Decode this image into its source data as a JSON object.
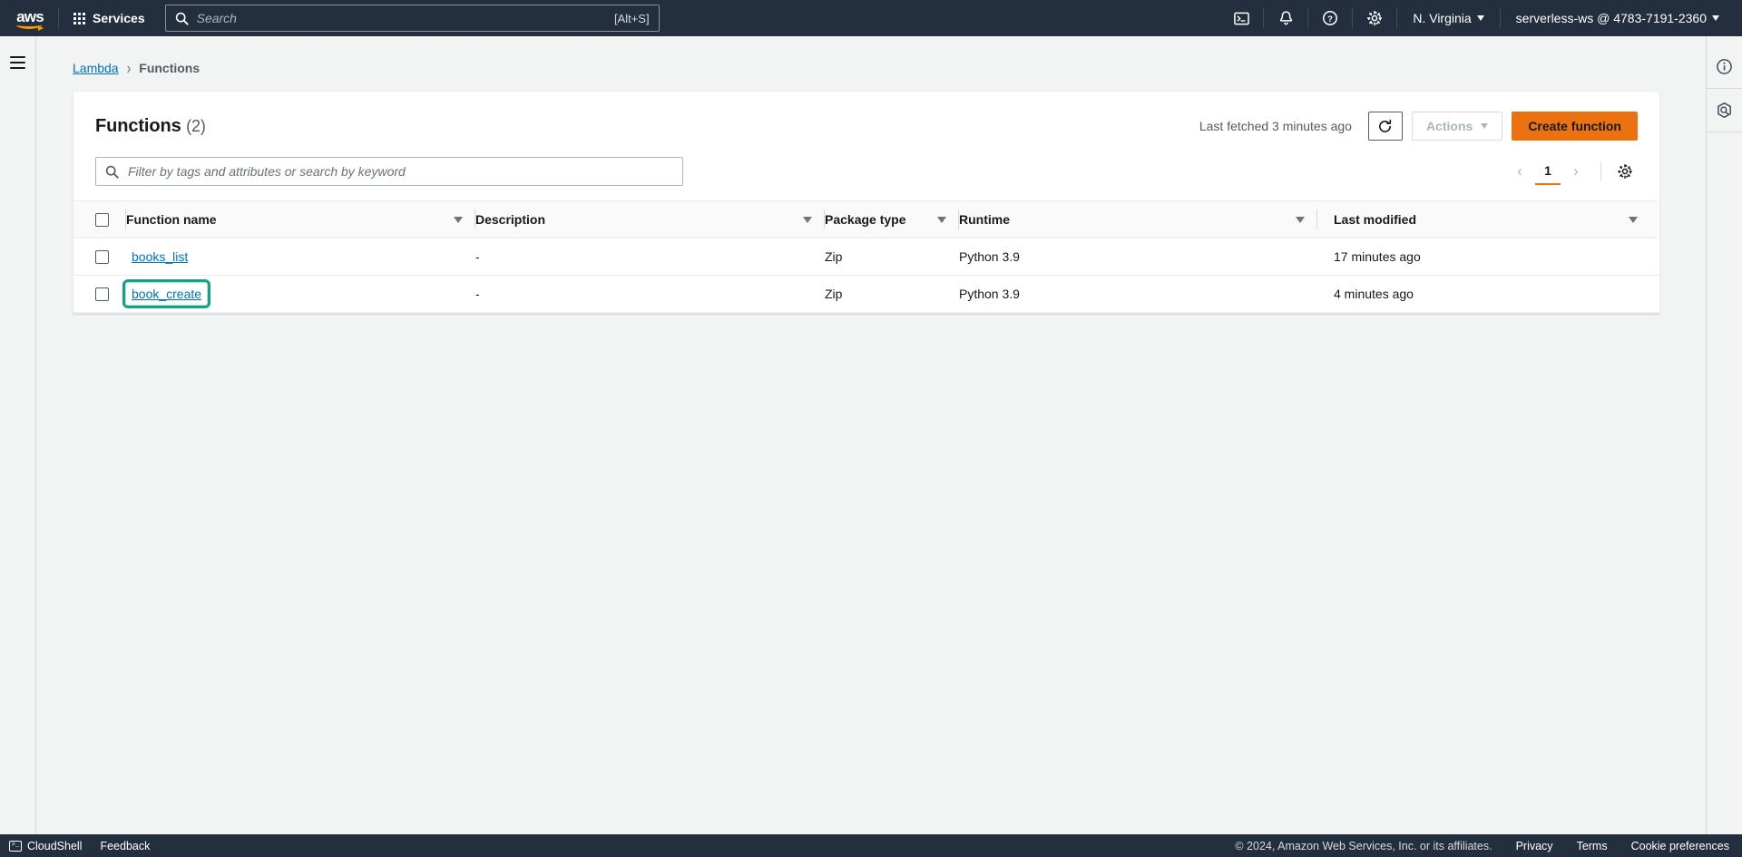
{
  "top_nav": {
    "logo_text": "aws",
    "services_label": "Services",
    "services_icon": "grid-icon",
    "search": {
      "placeholder": "Search",
      "value": "",
      "icon": "search-icon",
      "shortcut_hint": "[Alt+S]"
    },
    "icons": [
      {
        "name": "cloudshell-icon",
        "glyph": ">_"
      },
      {
        "name": "notifications-bell-icon",
        "glyph": "bell"
      },
      {
        "name": "help-question-icon",
        "glyph": "?"
      },
      {
        "name": "settings-gear-icon",
        "glyph": "gear"
      }
    ],
    "region_label": "N. Virginia",
    "account_label": "serverless-ws @ 4783-7191-2360"
  },
  "left_rail": {
    "menu_icon": "hamburger-menu-icon"
  },
  "right_rail": {
    "icons": [
      {
        "name": "info-circle-icon"
      },
      {
        "name": "cloudwatch-hexagon-icon"
      }
    ]
  },
  "breadcrumb": {
    "root": "Lambda",
    "separator": "›",
    "current": "Functions"
  },
  "card": {
    "title": "Functions",
    "count": "(2)",
    "last_fetched": "Last fetched 3 minutes ago",
    "refresh_icon": "refresh-icon",
    "actions_label": "Actions",
    "create_label": "Create function",
    "filter": {
      "placeholder": "Filter by tags and attributes or search by keyword",
      "value": "",
      "icon": "search-icon"
    },
    "pagination": {
      "prev": "‹",
      "page": "1",
      "next": "›",
      "settings_icon": "gear-icon"
    }
  },
  "table": {
    "columns": [
      {
        "label": "Function name",
        "sortable": true
      },
      {
        "label": "Description",
        "sortable": true
      },
      {
        "label": "Package type",
        "sortable": true
      },
      {
        "label": "Runtime",
        "sortable": true
      },
      {
        "label": "Last modified",
        "sortable": true
      }
    ],
    "rows": [
      {
        "name": "books_list",
        "description": "-",
        "package_type": "Zip",
        "runtime": "Python 3.9",
        "last_modified": "17 minutes ago",
        "focused": false
      },
      {
        "name": "book_create",
        "description": "-",
        "package_type": "Zip",
        "runtime": "Python 3.9",
        "last_modified": "4 minutes ago",
        "focused": true
      }
    ]
  },
  "footer": {
    "cloudshell": "CloudShell",
    "feedback": "Feedback",
    "copyright": "© 2024, Amazon Web Services, Inc. or its affiliates.",
    "privacy": "Privacy",
    "terms": "Terms",
    "cookie_preferences": "Cookie preferences"
  },
  "colors": {
    "nav_bg": "#232f3e",
    "accent_orange": "#ec7211",
    "link_blue": "#0073bb",
    "focus_teal": "#16a085",
    "page_bg": "#f2f3f3"
  }
}
